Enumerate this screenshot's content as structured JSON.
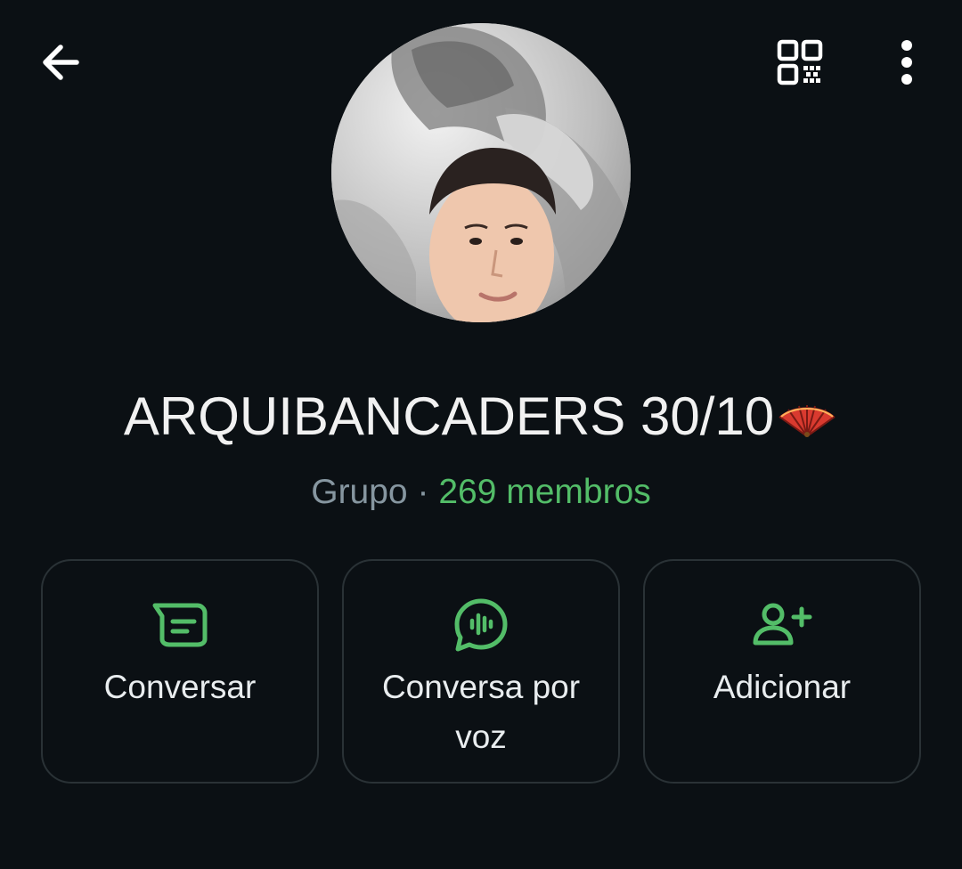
{
  "header": {
    "back_icon": "arrow-left-icon",
    "qr_icon": "qr-code-icon",
    "more_icon": "more-vertical-icon"
  },
  "group": {
    "name": "ARQUIBANCADERS 30/10",
    "name_emoji": "folding-fan-emoji",
    "type": "Grupo",
    "separator": "·",
    "members": "269 membros"
  },
  "actions": [
    {
      "label": "Conversar",
      "icon": "message-icon"
    },
    {
      "label": "Conversa por voz",
      "icon": "voice-chat-icon"
    },
    {
      "label": "Adicionar",
      "icon": "add-person-icon"
    }
  ],
  "colors": {
    "background": "#0b1014",
    "accent": "#53bd68",
    "text_primary": "#e9edef",
    "text_secondary": "#8696a0",
    "card_border": "#2a3236"
  }
}
